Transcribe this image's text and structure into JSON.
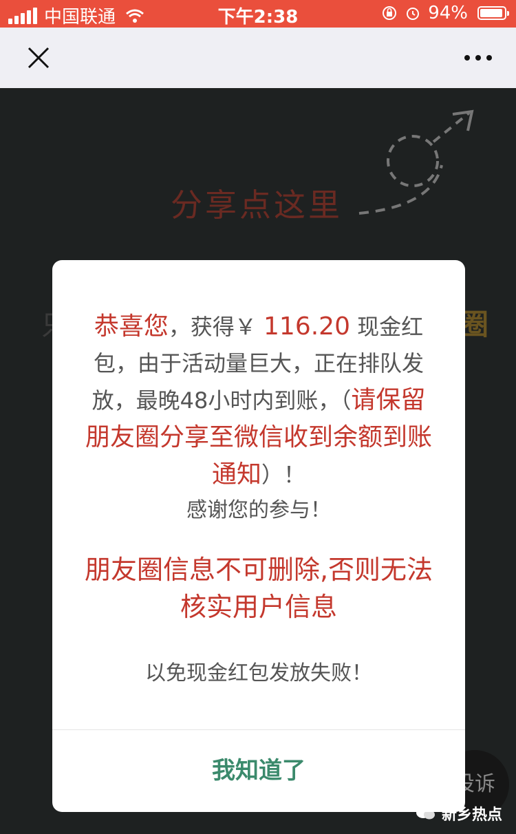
{
  "status_bar": {
    "carrier": "中国联通",
    "time": "下午2:38",
    "battery": "94%",
    "battery_level": 0.94
  },
  "nav": {
    "close_icon": "close-icon",
    "more_icon": "more-icon"
  },
  "background": {
    "share_hint": "分享点这里",
    "left_char": "只",
    "right_char": "圈",
    "complain_label": "投诉",
    "watermark": "新乡热点"
  },
  "dialog": {
    "line1_congrats": "恭喜您",
    "line1_got": "，获得￥",
    "amount": "116.20",
    "line1_rest": "现金红包，由于活动量巨大，正在排队发放，最晚48小时内到账，（",
    "highlight": "请保留朋友圈分享至微信收到余额到账通知",
    "after_highlight": "）！",
    "thanks": "感谢您的参与！",
    "warning": "朋友圈信息不可删除,否则无法核实用户信息",
    "avoid": "以免现金红包发放失败！",
    "confirm": "我知道了"
  },
  "colors": {
    "status_bar": "#ea4f3c",
    "accent_red": "#c4382d",
    "confirm_green": "#3b8a6c"
  }
}
